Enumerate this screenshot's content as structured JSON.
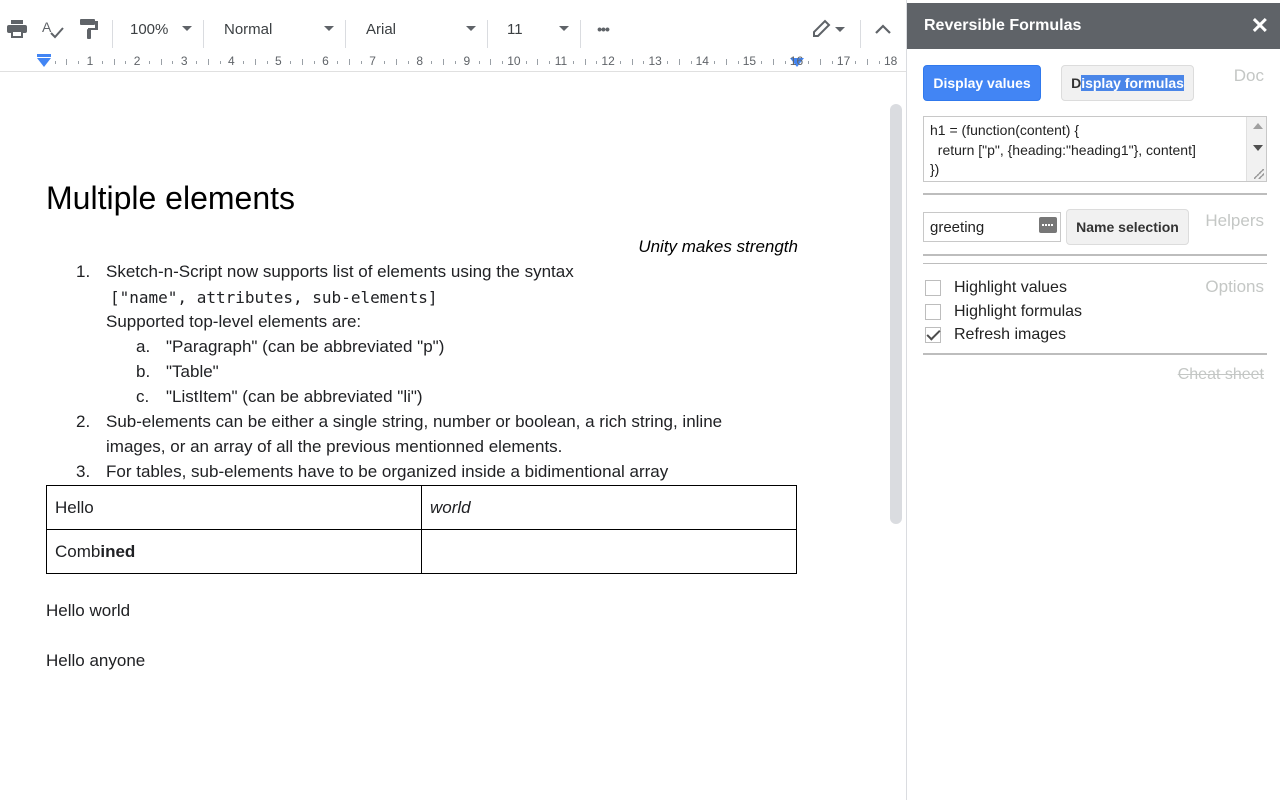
{
  "toolbar": {
    "zoom": "100%",
    "style": "Normal",
    "font": "Arial",
    "font_size": "11",
    "more": "•••"
  },
  "ruler": {
    "marks": [
      "1",
      "2",
      "3",
      "4",
      "5",
      "6",
      "7",
      "8",
      "9",
      "10",
      "11",
      "12",
      "13",
      "14",
      "15",
      "16",
      "17",
      "18"
    ]
  },
  "document": {
    "title": "Multiple elements",
    "quote": "Unity makes strength",
    "list": {
      "item1_num": "1.",
      "item1_text": "Sketch-n-Script now supports list of elements using the syntax",
      "item1_code": "[\"name\", attributes, sub-elements]",
      "item1_sub": "Supported top-level elements are:",
      "sub_a_num": "a.",
      "sub_a": "\"Paragraph\" (can be abbreviated \"p\")",
      "sub_b_num": "b.",
      "sub_b": "\"Table\"",
      "sub_c_num": "c.",
      "sub_c": "\"ListItem\" (can be abbreviated \"li\")",
      "item2_num": "2.",
      "item2_line1": "Sub-elements can be either a single string, number or boolean, a rich string, inline",
      "item2_line2": "images, or an array of all the previous mentionned elements.",
      "item3_num": "3.",
      "item3_text": "For tables, sub-elements have to be organized inside a bidimentional array"
    },
    "table": {
      "r1c1": "Hello",
      "r1c2": "world",
      "r2c1_plain": "Comb",
      "r2c1_bold": "ined",
      "r2c2": ""
    },
    "para1": "Hello world",
    "para2": "Hello anyone"
  },
  "panel": {
    "title": "Reversible Formulas",
    "close": "✕",
    "display_values": "Display values",
    "display_formulas_prefix": "D",
    "display_formulas_rest": "isplay formulas",
    "doc_label": "Doc",
    "formula_text": "h1 = (function(content) {\n  return [\"p\", {heading:\"heading1\"}, content]\n})",
    "name_input_value": "greeting",
    "name_selection": "Name selection",
    "helpers_label": "Helpers",
    "options_label": "Options",
    "opt_highlight_values": "Highlight values",
    "opt_highlight_formulas": "Highlight formulas",
    "opt_refresh_images": "Refresh images",
    "cheat_sheet": "Cheat sheet"
  }
}
